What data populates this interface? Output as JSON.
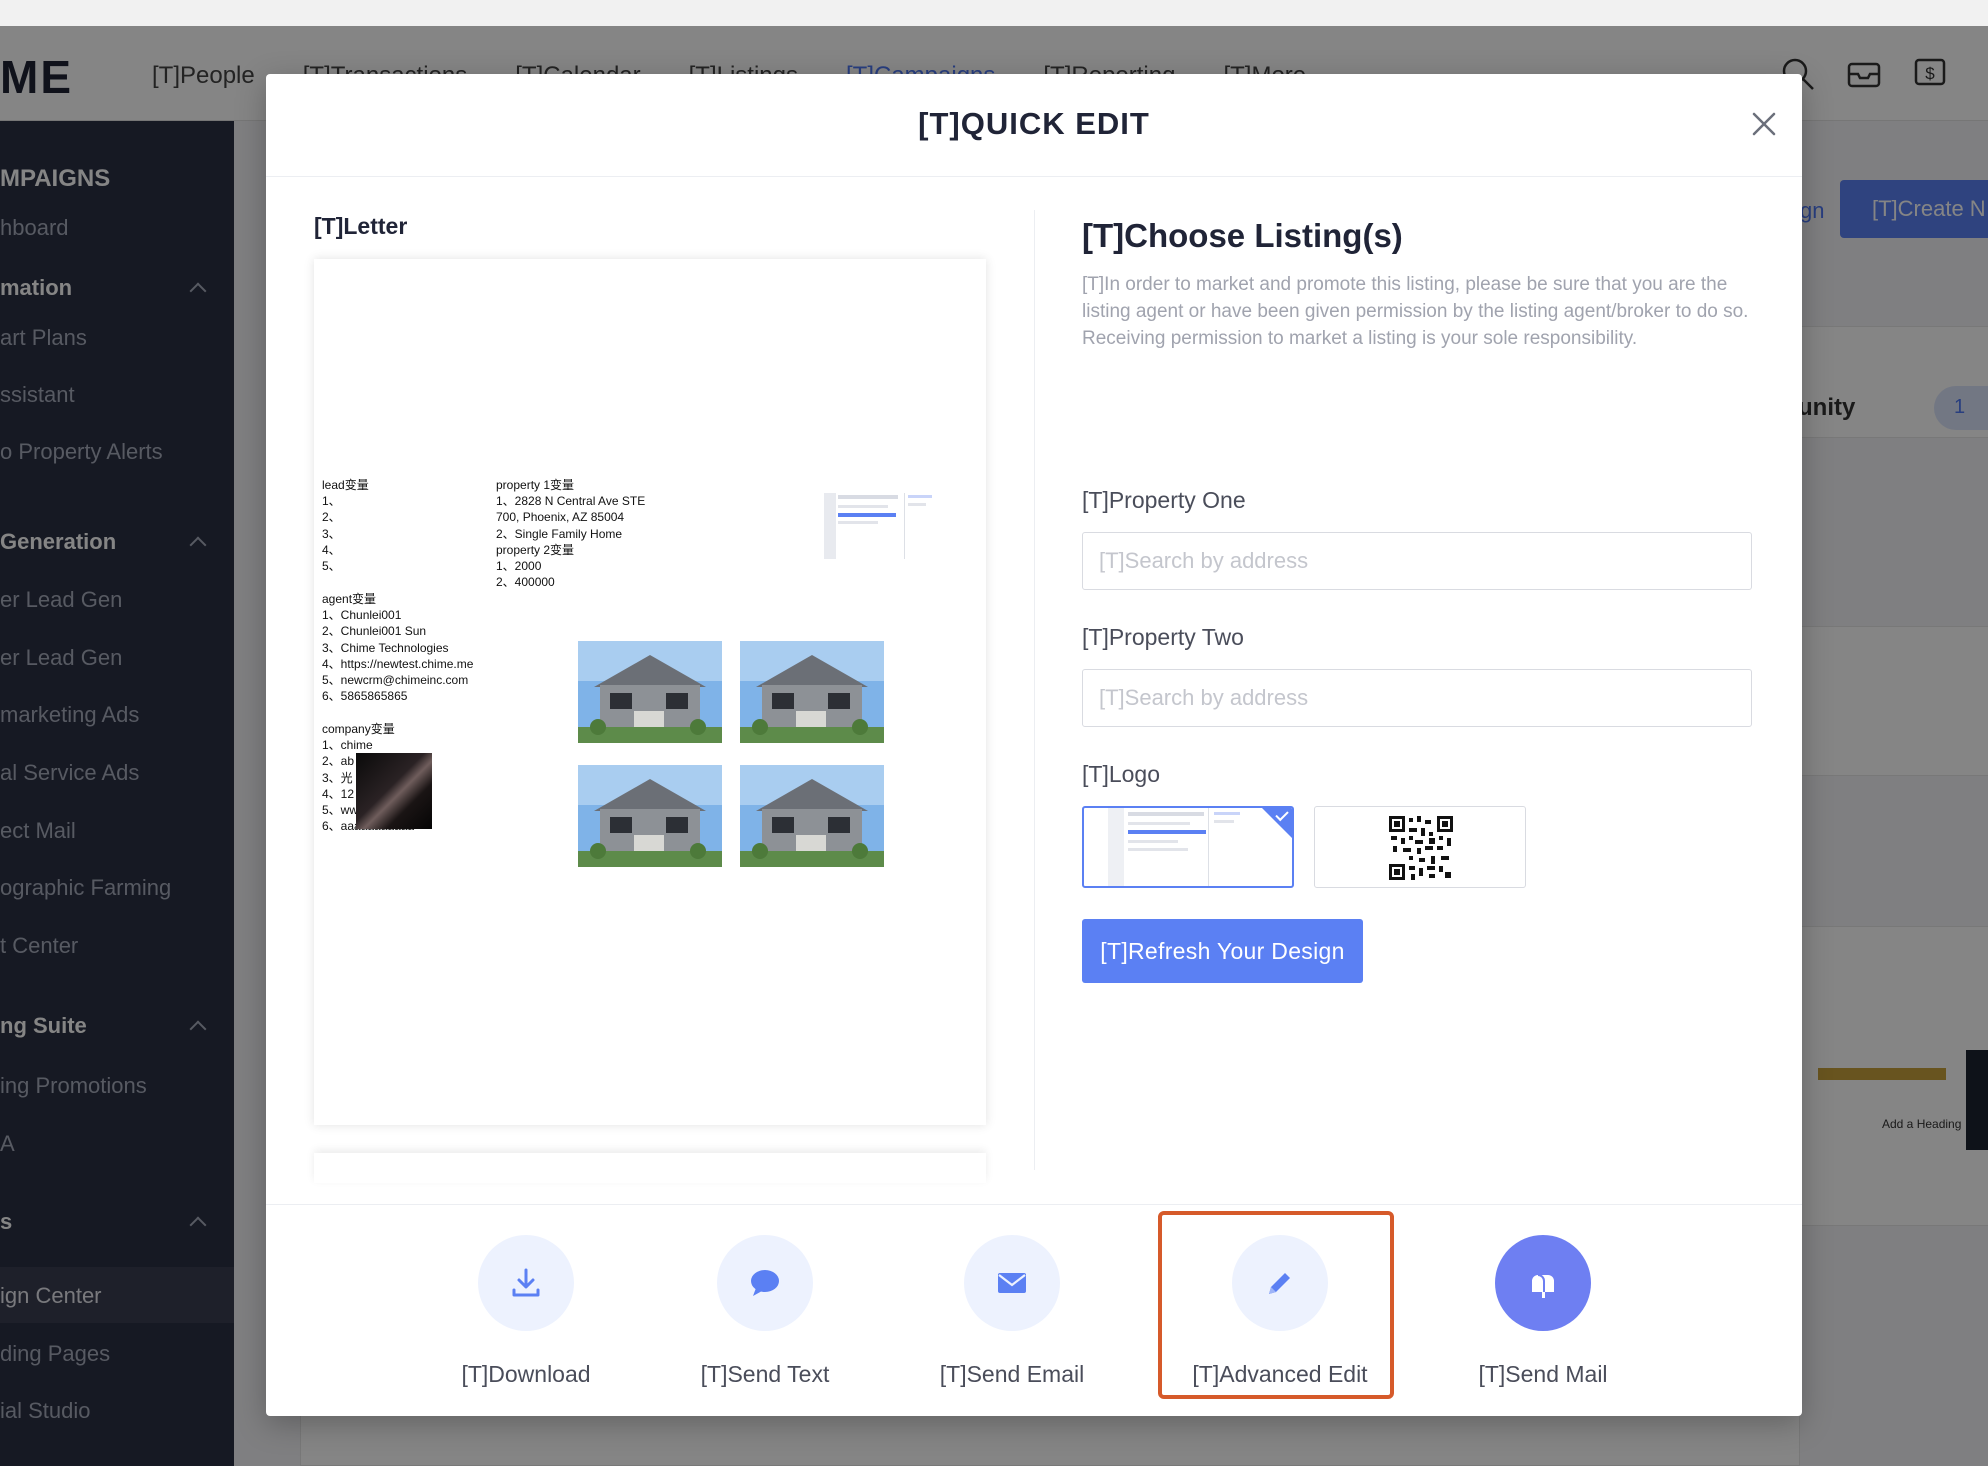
{
  "app": {
    "logo": "ME",
    "nav": [
      "[T]People",
      "[T]Transactions",
      "[T]Calendar",
      "[T]Listings",
      "[T]Campaigns",
      "[T]Reporting",
      "[T]More"
    ],
    "active_nav": "[T]Campaigns"
  },
  "sidebar": {
    "items": [
      {
        "label": "MPAIGNS",
        "type": "head"
      },
      {
        "label": "hboard",
        "type": "item"
      },
      {
        "label": "mation",
        "type": "section"
      },
      {
        "label": "art Plans",
        "type": "item"
      },
      {
        "label": "ssistant",
        "type": "item"
      },
      {
        "label": "o Property Alerts",
        "type": "item"
      },
      {
        "label": " Generation",
        "type": "section"
      },
      {
        "label": "er Lead Gen",
        "type": "item"
      },
      {
        "label": "er Lead Gen",
        "type": "item"
      },
      {
        "label": "marketing Ads",
        "type": "item"
      },
      {
        "label": "al Service Ads",
        "type": "item"
      },
      {
        "label": "ect Mail",
        "type": "item"
      },
      {
        "label": "ographic Farming",
        "type": "item"
      },
      {
        "label": "t Center",
        "type": "item"
      },
      {
        "label": "ng Suite",
        "type": "section"
      },
      {
        "label": "ing Promotions",
        "type": "item"
      },
      {
        "label": "A",
        "type": "item"
      },
      {
        "label": "s",
        "type": "section"
      },
      {
        "label": "ign Center",
        "type": "selected"
      },
      {
        "label": "ding Pages",
        "type": "item"
      },
      {
        "label": "ial Studio",
        "type": "item"
      }
    ]
  },
  "background": {
    "create_button": "[T]Create N",
    "link": "gn",
    "heading": "unity",
    "pill": "1",
    "add_heading": "Add a\nHeading"
  },
  "modal": {
    "title": "[T]QUICK EDIT",
    "letter_label": "[T]Letter",
    "letter": {
      "lead_block": "lead变量\n1、\n2、\n3、\n4、\n5、",
      "property_block": "property 1变量\n1、2828 N Central Ave STE\n700, Phoenix, AZ 85004\n2、Single Family Home\nproperty 2变量\n1、2000\n2、400000",
      "agent_block": "agent变量\n1、Chunlei001\n2、Chunlei001 Sun\n3、Chime Technologies\n4、https://newtest.chime.me\n5、newcrm@chimeinc.com\n6、5865865865",
      "company_block": "company变量\n1、chime\n2、ab\n3、光\n4、12\n5、ww\n6、aaaaaaaaaaa"
    },
    "choose_title": "[T]Choose Listing(s)",
    "choose_desc": "[T]In order to market and promote this listing, please be sure that you are the listing agent or have been given permission by the listing agent/broker to do so. Receiving permission to market a listing is your sole responsibility.",
    "property_one_label": "[T]Property One",
    "property_one_placeholder": "[T]Search by address",
    "property_two_label": "[T]Property Two",
    "property_two_placeholder": "[T]Search by address",
    "logo_label": "[T]Logo",
    "refresh_button": "[T]Refresh Your Design",
    "actions": [
      {
        "label": "[T]Download",
        "icon": "download-icon"
      },
      {
        "label": "[T]Send Text",
        "icon": "chat-bubble-icon"
      },
      {
        "label": "[T]Send Email",
        "icon": "envelope-icon"
      },
      {
        "label": "[T]Advanced Edit",
        "icon": "pencil-icon",
        "highlighted": true
      },
      {
        "label": "[T]Send Mail",
        "icon": "mailbox-icon"
      }
    ]
  },
  "colors": {
    "accent": "#5b80f3",
    "highlight": "#d65a2a",
    "sidebar": "#2b3043"
  }
}
